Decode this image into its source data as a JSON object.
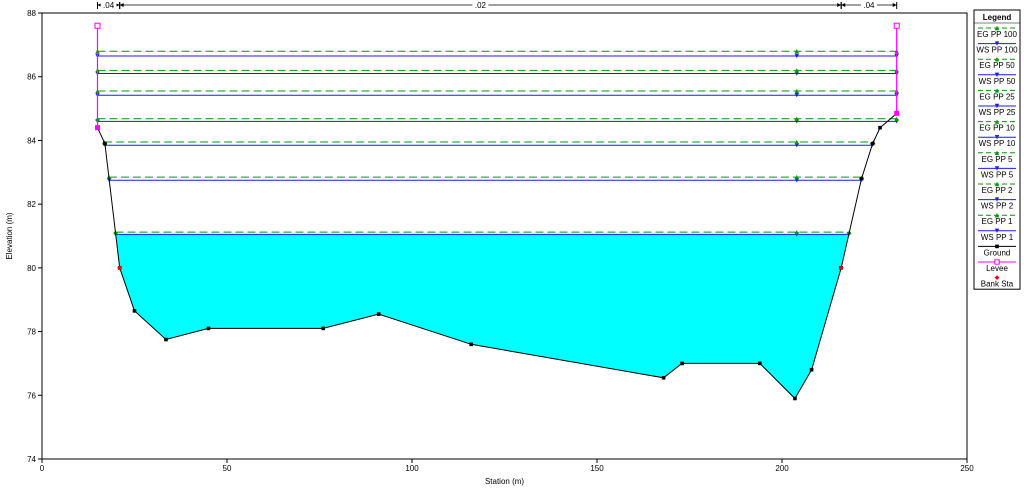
{
  "chart_data": {
    "type": "line",
    "title": "",
    "xlabel": "Station (m)",
    "ylabel": "Elevation (m)",
    "xlim": [
      0,
      250
    ],
    "ylim": [
      74,
      88
    ],
    "xticks": [
      0,
      50,
      100,
      150,
      200,
      250
    ],
    "yticks": [
      74,
      76,
      78,
      80,
      82,
      84,
      86,
      88
    ],
    "grid": false,
    "legend_position": "right",
    "legend_title": "Legend",
    "colors": {
      "ground": "#000000",
      "water_fill": "#00ffff",
      "ws": "#1a1aff",
      "eg": "#009900",
      "levee": "#ff00ff",
      "bank": "#ff0000"
    },
    "manning_n": [
      {
        "label": ".04",
        "from": 15,
        "to": 21
      },
      {
        "label": ".02",
        "from": 21,
        "to": 216
      },
      {
        "label": ".04",
        "from": 216,
        "to": 231
      }
    ],
    "ground": {
      "name": "Ground",
      "x": [
        15,
        17,
        21,
        25,
        33.5,
        45,
        76,
        91,
        116,
        168,
        173,
        194,
        203.5,
        208,
        216,
        221.5,
        224.5,
        226.5,
        231
      ],
      "y": [
        84.4,
        83.9,
        80.0,
        78.65,
        77.75,
        78.1,
        78.1,
        78.55,
        77.6,
        76.55,
        77.0,
        77.0,
        75.9,
        76.8,
        80.0,
        82.8,
        83.9,
        84.4,
        84.85
      ]
    },
    "levee": {
      "name": "Levee",
      "points": [
        {
          "x": 15,
          "top": 87.6,
          "bottom": 84.4
        },
        {
          "x": 231,
          "top": 87.6,
          "bottom": 84.85
        }
      ]
    },
    "bank_stations": {
      "name": "Bank Sta",
      "x": [
        21,
        216
      ],
      "y": [
        80.0,
        80.0
      ]
    },
    "profiles": [
      {
        "name": "WS PP 1",
        "kind": "ws",
        "elev": 81.05,
        "filled": true
      },
      {
        "name": "EG PP 1",
        "kind": "eg",
        "elev": 81.12
      },
      {
        "name": "WS PP 2",
        "kind": "ws",
        "elev": 82.75
      },
      {
        "name": "EG PP 2",
        "kind": "eg",
        "elev": 82.85
      },
      {
        "name": "WS PP 5",
        "kind": "ws",
        "elev": 83.85
      },
      {
        "name": "EG PP 5",
        "kind": "eg",
        "elev": 83.95
      },
      {
        "name": "WS PP 10",
        "kind": "ws",
        "elev": 84.6
      },
      {
        "name": "EG PP 10",
        "kind": "eg",
        "elev": 84.68
      },
      {
        "name": "WS PP 25",
        "kind": "ws",
        "elev": 85.42
      },
      {
        "name": "EG PP 25",
        "kind": "eg",
        "elev": 85.55
      },
      {
        "name": "WS PP 50",
        "kind": "ws",
        "elev": 86.1
      },
      {
        "name": "EG PP 50",
        "kind": "eg",
        "elev": 86.2
      },
      {
        "name": "WS PP 100",
        "kind": "ws",
        "elev": 86.65
      },
      {
        "name": "EG PP 100",
        "kind": "eg",
        "elev": 86.8
      }
    ],
    "legend_order": [
      "EG PP 100",
      "WS PP 100",
      "EG PP 50",
      "WS PP 50",
      "EG PP 25",
      "WS PP 25",
      "EG PP 10",
      "WS PP 10",
      "EG PP 5",
      "WS PP 5",
      "EG PP 2",
      "WS PP 2",
      "EG PP 1",
      "WS PP 1",
      "Ground",
      "Levee",
      "Bank Sta"
    ]
  }
}
